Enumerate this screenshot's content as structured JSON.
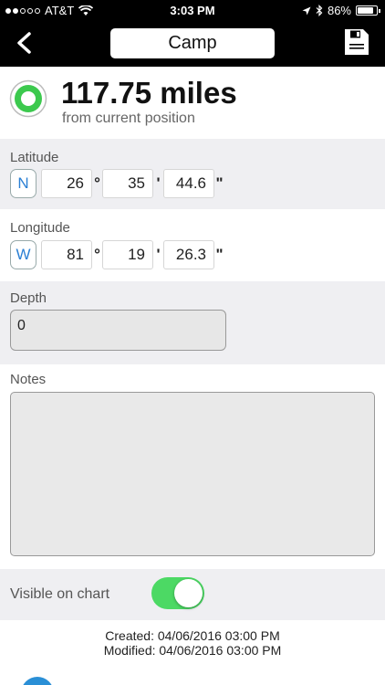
{
  "status_bar": {
    "carrier": "AT&T",
    "time": "3:03 PM",
    "battery_percent_text": "86%",
    "battery_level": 0.86,
    "signal_bars_filled": 2,
    "signal_bars_total": 5
  },
  "nav": {
    "title": "Camp",
    "back_icon": "chevron-left-icon",
    "save_icon": "save-icon"
  },
  "distance": {
    "value": "117.75 miles",
    "subtitle": "from current position",
    "icon": "waypoint-target-icon",
    "accent_color": "#4cd964"
  },
  "latitude": {
    "label": "Latitude",
    "hemisphere": "N",
    "degrees": "26",
    "minutes": "35",
    "seconds": "44.6",
    "degree_symbol": "°",
    "minute_symbol": "'",
    "second_symbol": "\""
  },
  "longitude": {
    "label": "Longitude",
    "hemisphere": "W",
    "degrees": "81",
    "minutes": "19",
    "seconds": "26.3",
    "degree_symbol": "°",
    "minute_symbol": "'",
    "second_symbol": "\""
  },
  "depth": {
    "label": "Depth",
    "value": "0"
  },
  "notes": {
    "label": "Notes",
    "value": ""
  },
  "visibility": {
    "label": "Visible on chart",
    "enabled": true
  },
  "dates": {
    "created": "Created: 04/06/2016 03:00 PM",
    "modified": "Modified: 04/06/2016 03:00 PM"
  },
  "colors": {
    "hemisphere_text": "#2a7fd4",
    "toggle_on": "#4cd964",
    "section_gray": "#efeff2"
  }
}
